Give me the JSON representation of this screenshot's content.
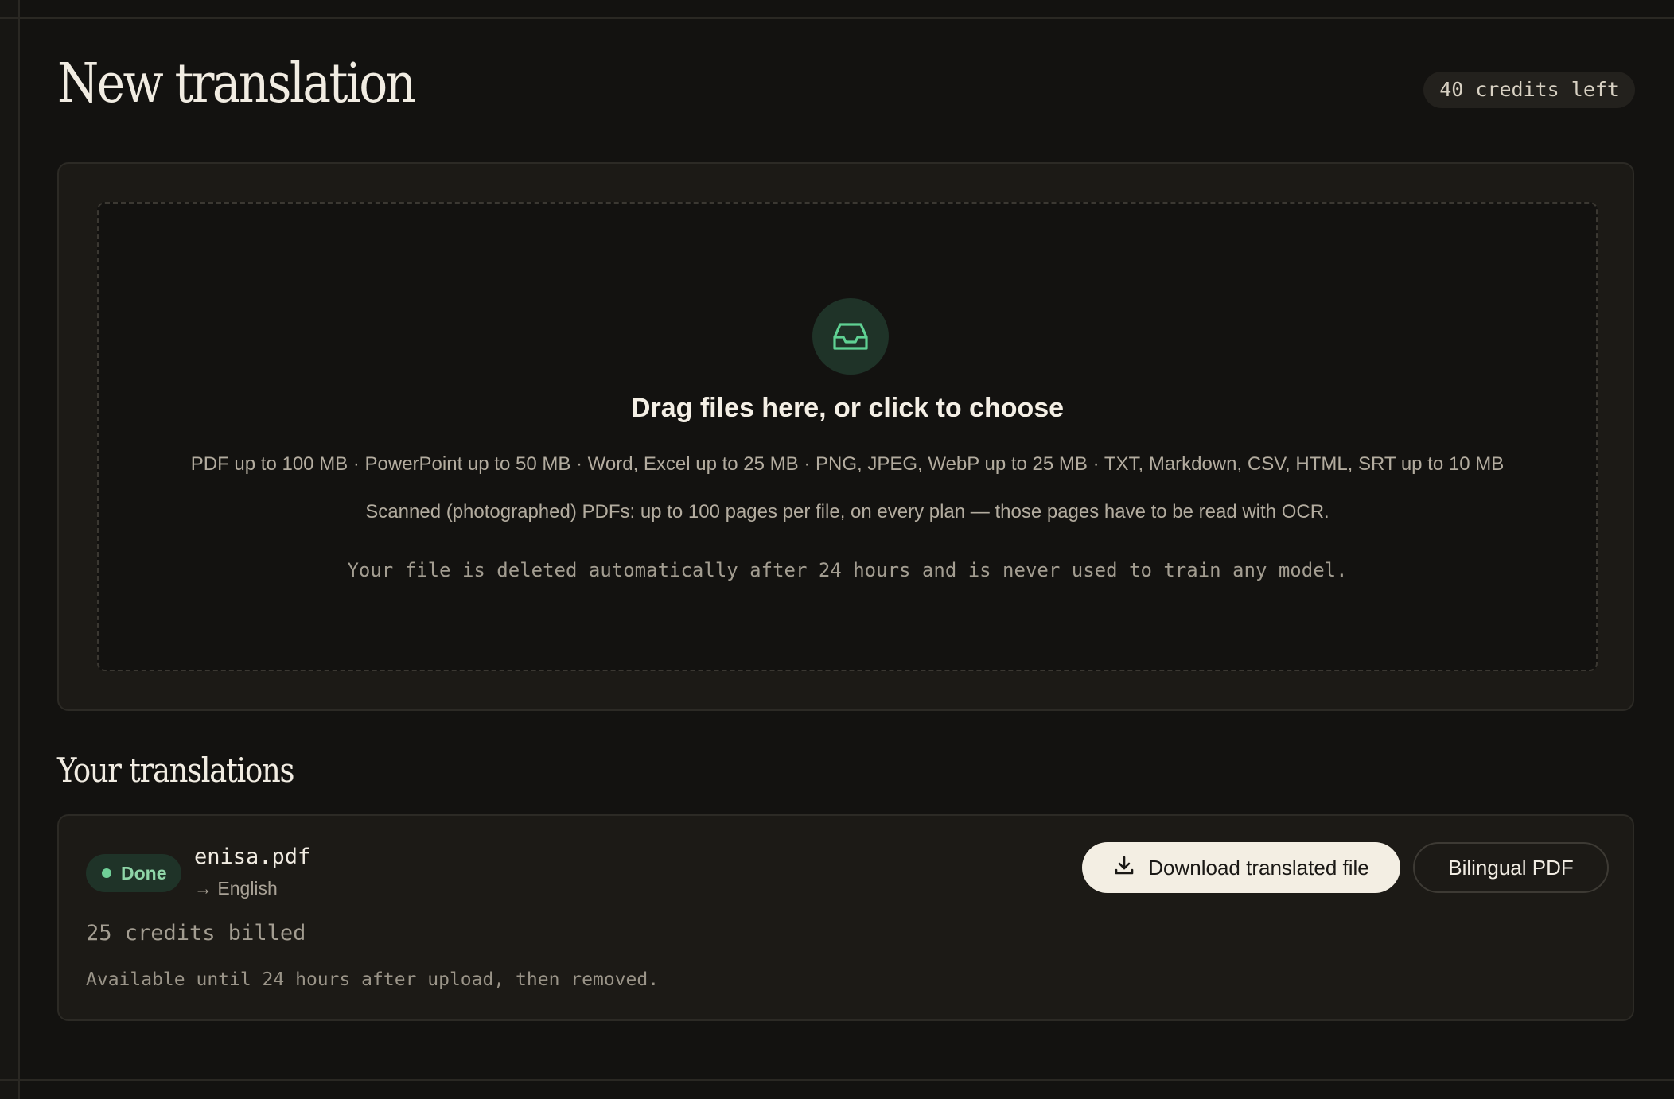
{
  "header": {
    "title": "New translation",
    "credits_left": "40 credits left"
  },
  "upload": {
    "icon": "inbox-icon",
    "title": "Drag files here, or click to choose",
    "formats": "PDF up to 100 MB · PowerPoint up to 50 MB · Word, Excel up to 25 MB · PNG, JPEG, WebP up to 25 MB · TXT, Markdown, CSV, HTML, SRT up to 10 MB",
    "ocr_note": "Scanned (photographed) PDFs: up to 100 pages per file, on every plan — those pages have to be read with OCR.",
    "privacy_note": "Your file is deleted automatically after 24 hours and is never used to train any model."
  },
  "translations": {
    "title": "Your translations",
    "items": [
      {
        "status": "Done",
        "file_name": "enisa.pdf",
        "target_language": "→ English",
        "download_label": "Download translated file",
        "download_icon": "download-icon",
        "bilingual_label": "Bilingual PDF",
        "credits_billed": "25 credits billed",
        "availability": "Available until 24 hours after upload, then removed."
      }
    ]
  },
  "colors": {
    "background": "#131210",
    "card": "#1c1a16",
    "accent_green": "#6fcf97",
    "icon_circle": "#1f3328",
    "primary_button": "#f3eee3"
  }
}
